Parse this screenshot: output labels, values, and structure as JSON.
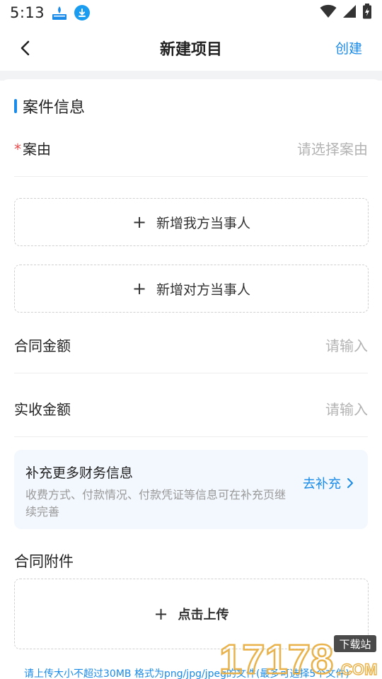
{
  "status_bar": {
    "time": "5:13",
    "icons": [
      "app-notification-icon",
      "download-icon",
      "wifi-icon",
      "signal-icon",
      "battery-charging-icon"
    ]
  },
  "nav": {
    "title": "新建项目",
    "action_label": "创建",
    "back_icon": "chevron-left-icon"
  },
  "section": {
    "title": "案件信息",
    "accent_color": "#1a8be8"
  },
  "case_reason": {
    "required_mark": "*",
    "label": "案由",
    "placeholder": "请选择案由"
  },
  "add_our_party": {
    "plus": "+",
    "label": "新增我方当事人"
  },
  "add_other_party": {
    "plus": "+",
    "label": "新增对方当事人"
  },
  "contract_amount": {
    "label": "合同金额",
    "placeholder": "请输入"
  },
  "received_amount": {
    "label": "实收金额",
    "placeholder": "请输入"
  },
  "finance": {
    "title": "补充更多财务信息",
    "description": "收费方式、付款情况、付款凭证等信息可在补充页继续完善",
    "link_label": "去补充"
  },
  "attachments": {
    "title": "合同附件",
    "upload_plus": "+",
    "upload_label": "点击上传",
    "note": "请上传大小不超过30MB 格式为png/jpg/jpeg的文件(最多可选择5个文件)"
  },
  "watermark": {
    "number": "17178",
    "badge": "下载站",
    "suffix": ".COM"
  },
  "colors": {
    "accent": "#1a8be8",
    "required": "#e84a4a",
    "placeholder": "#b3b3b3",
    "finance_bg": "#f3f8fe"
  }
}
